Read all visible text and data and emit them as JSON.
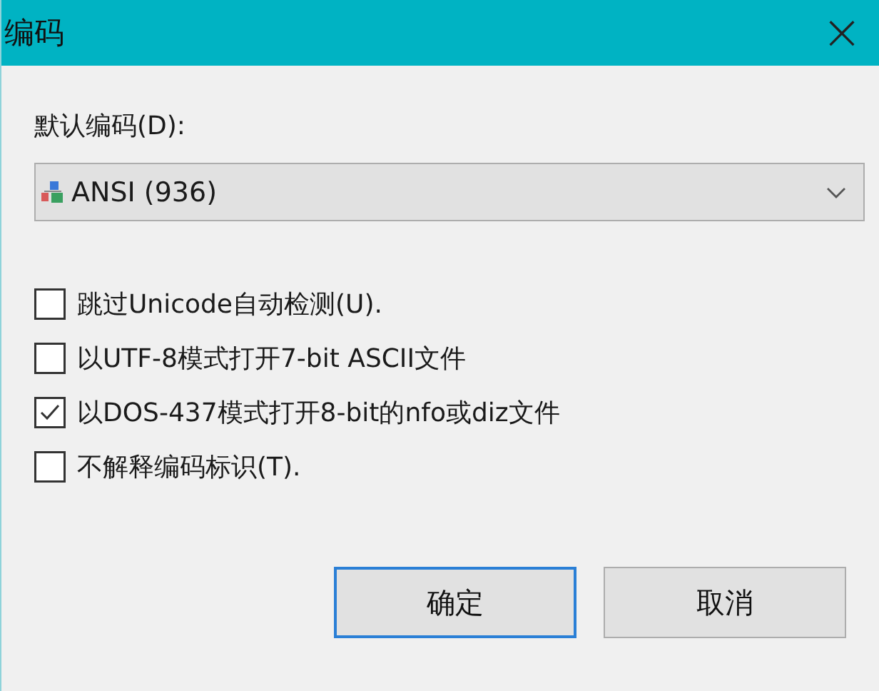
{
  "window": {
    "title": "编码",
    "close": "×"
  },
  "encoding": {
    "label": "默认编码(D):",
    "value": "ANSI (936)"
  },
  "options": [
    {
      "label": "跳过Unicode自动检测(U).",
      "checked": false
    },
    {
      "label": "以UTF-8模式打开7-bit ASCII文件",
      "checked": false
    },
    {
      "label": "以DOS-437模式打开8-bit的nfo或diz文件",
      "checked": true
    },
    {
      "label": "不解释编码标识(T).",
      "checked": false
    }
  ],
  "buttons": [
    {
      "label": "确定",
      "default": true
    },
    {
      "label": "取消",
      "default": false
    }
  ]
}
